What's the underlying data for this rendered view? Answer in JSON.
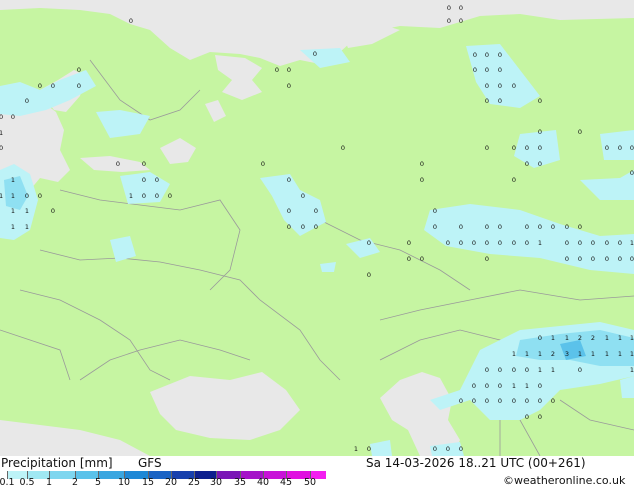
{
  "title_left": "Precipitation [mm]",
  "model": "GFS",
  "valid_time": "Sa 14-03-2026 18..21 UTC (00+261)",
  "credit": "©weatheronline.co.uk",
  "colorbar": {
    "labels": [
      "0.1",
      "0.5",
      "1",
      "2",
      "5",
      "10",
      "15",
      "20",
      "25",
      "30",
      "35",
      "40",
      "45",
      "50"
    ],
    "colors": [
      "#bdf3f7",
      "#a0e8f3",
      "#7ed6ef",
      "#5bc2ea",
      "#3aa6e0",
      "#1e88d6",
      "#1a63c4",
      "#1740ad",
      "#0d1f8e",
      "#7a16b6",
      "#a514c8",
      "#c812d8",
      "#e010e0",
      "#f31ef0"
    ]
  },
  "colors": {
    "land": "#c6f5a2",
    "sea": "#e8e8e8",
    "precip_light": "#bdf3f7",
    "precip_mid": "#8fe0f2",
    "border": "#9a9a9a"
  },
  "grid_values": {
    "north_scandinavia": [
      "0",
      "0",
      "0",
      "0",
      "0",
      "0",
      "0",
      "0",
      "0"
    ],
    "baltic": [
      "1",
      "1",
      "1",
      "1",
      "1",
      "1",
      "0",
      "0",
      "0",
      "1",
      "1",
      "1"
    ],
    "east_russia": [
      "1",
      "0",
      "0",
      "0",
      "0",
      "0",
      "0",
      "0",
      "0",
      "0",
      "0",
      "0"
    ],
    "central_asia": [
      "1",
      "1",
      "2",
      "2",
      "1",
      "1",
      "1",
      "1",
      "1",
      "2",
      "3",
      "1",
      "1",
      "1",
      "1",
      "1",
      "1",
      "0",
      "0",
      "0",
      "1",
      "0"
    ]
  }
}
